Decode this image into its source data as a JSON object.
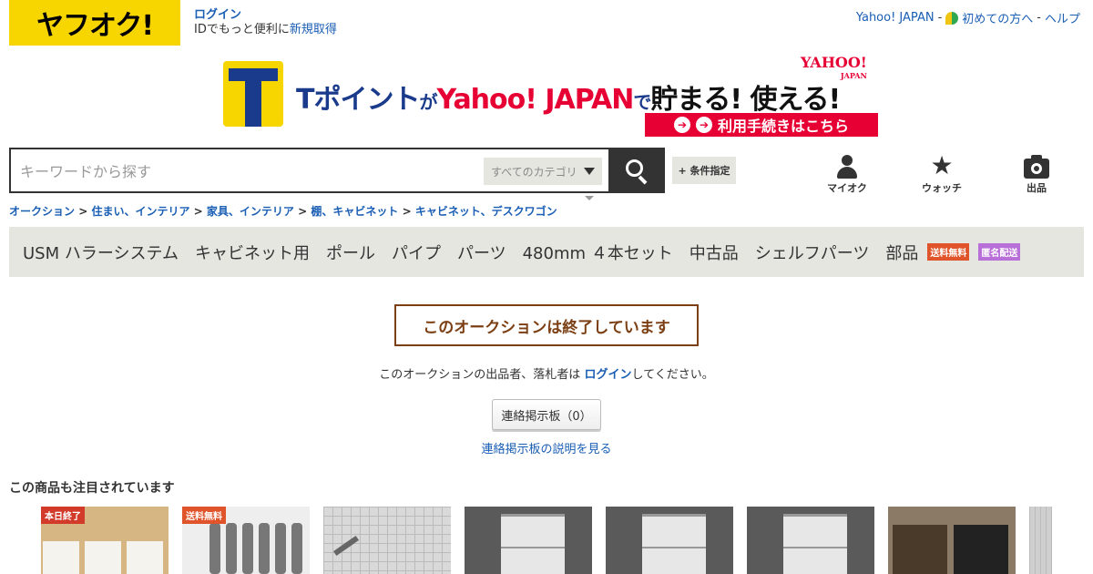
{
  "header": {
    "logo_text": "ヤフオク!",
    "login_label": "ログイン",
    "id_text": "IDでもっと便利に",
    "register_label": "新規取得",
    "links": [
      "Yahoo! JAPAN",
      "初めての方へ",
      "ヘルプ"
    ],
    "separator": "-"
  },
  "banner": {
    "tpoint": "Tポイント",
    "ga": "が",
    "yahoo_japan": "Yahoo! JAPAN",
    "de": "で",
    "tamaru": "貯まる! 使える!",
    "yahoo_logo": "YAHOO!",
    "yahoo_logo_sub": "JAPAN",
    "cta": "利用手続きはこちら"
  },
  "search": {
    "placeholder": "キーワードから探す",
    "category": "すべてのカテゴリ",
    "condition_label": "+ 条件指定"
  },
  "tools": [
    {
      "label": "マイオク",
      "icon": "person-icon"
    },
    {
      "label": "ウォッチ",
      "icon": "star-icon"
    },
    {
      "label": "出品",
      "icon": "camera-icon"
    }
  ],
  "breadcrumb": [
    "オークション",
    "住まい、インテリア",
    "家具、インテリア",
    "棚、キャビネット",
    "キャビネット、デスクワゴン"
  ],
  "breadcrumb_sep": ">",
  "item": {
    "title": "USM ハラーシステム　キャビネット用　ポール　パイプ　パーツ　480mm ４本セット　中古品　シェルフパーツ　部品",
    "badges": [
      "送料無料",
      "匿名配送"
    ]
  },
  "ended": {
    "banner": "このオークションは終了しています",
    "message_before": "このオークションの出品者、落札者は",
    "login_link": "ログイン",
    "message_after": "してください。",
    "board_button": "連絡掲示板（0）",
    "board_link": "連絡掲示板の説明を見る"
  },
  "related": {
    "title": "この商品も注目されています",
    "tags": [
      "本日終了",
      "送料無料"
    ]
  },
  "colors": {
    "brand_yellow": "#f7d600",
    "link_blue": "#1a5eb4",
    "ended_brown": "#7b3f13",
    "title_bg": "#e6e6e1"
  }
}
